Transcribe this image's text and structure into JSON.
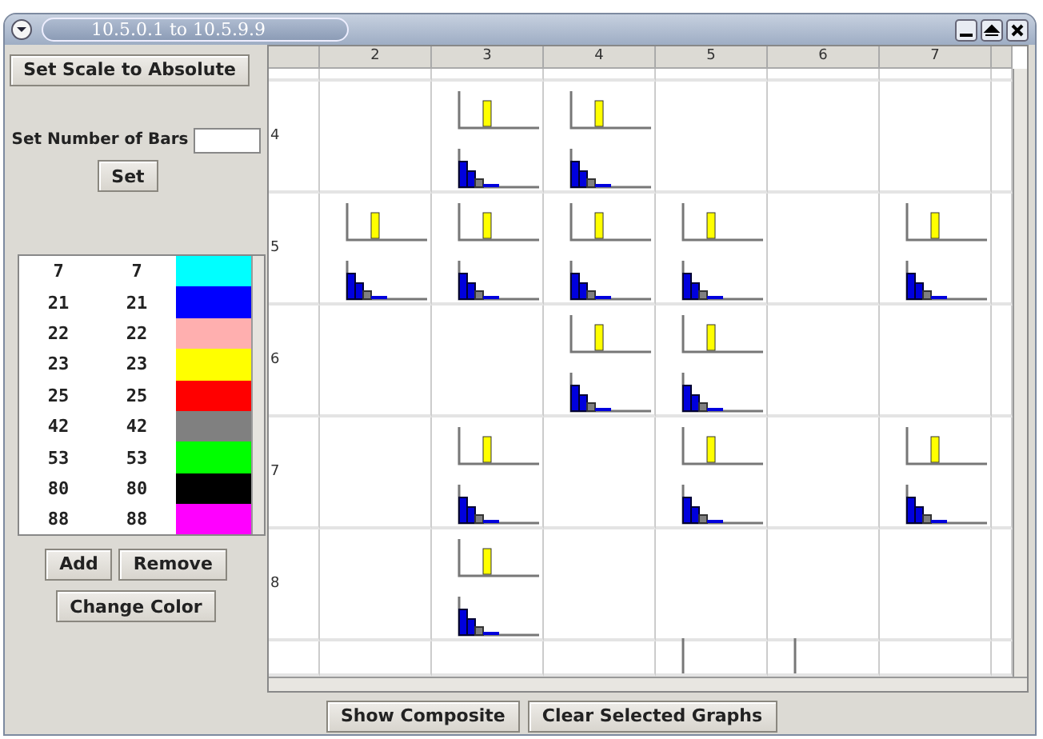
{
  "window": {
    "title": "10.5.0.1 to 10.5.9.9"
  },
  "scale_button": "Set Scale to Absolute",
  "bars_label": "Set Number of Bars",
  "set_button": "Set",
  "color_list": [
    {
      "from": "7",
      "to": "7",
      "color": "#00ffff"
    },
    {
      "from": "21",
      "to": "21",
      "color": "#0000ff"
    },
    {
      "from": "22",
      "to": "22",
      "color": "#ffafaf"
    },
    {
      "from": "23",
      "to": "23",
      "color": "#ffff00"
    },
    {
      "from": "25",
      "to": "25",
      "color": "#ff0000"
    },
    {
      "from": "42",
      "to": "42",
      "color": "#808080"
    },
    {
      "from": "53",
      "to": "53",
      "color": "#00ff00"
    },
    {
      "from": "80",
      "to": "80",
      "color": "#000000"
    },
    {
      "from": "88",
      "to": "88",
      "color": "#ff00ff"
    }
  ],
  "list_buttons": [
    "Add",
    "Remove",
    "Change Color"
  ],
  "grid": {
    "columns": [
      "2",
      "3",
      "4",
      "5",
      "6",
      "7"
    ],
    "rows": [
      {
        "label": "4",
        "cells": [
          {
            "graph": false
          },
          {
            "graph": true
          },
          {
            "graph": true
          },
          {
            "graph": false
          },
          {
            "graph": false
          },
          {
            "graph": false
          }
        ]
      },
      {
        "label": "5",
        "cells": [
          {
            "graph": true
          },
          {
            "graph": true
          },
          {
            "graph": true
          },
          {
            "graph": true
          },
          {
            "graph": false
          },
          {
            "graph": true
          }
        ]
      },
      {
        "label": "6",
        "cells": [
          {
            "graph": false
          },
          {
            "graph": false
          },
          {
            "graph": true
          },
          {
            "graph": true
          },
          {
            "graph": false
          },
          {
            "graph": false
          }
        ]
      },
      {
        "label": "7",
        "cells": [
          {
            "graph": false
          },
          {
            "graph": true
          },
          {
            "graph": false
          },
          {
            "graph": true
          },
          {
            "graph": false
          },
          {
            "graph": true
          }
        ]
      },
      {
        "label": "8",
        "cells": [
          {
            "graph": false
          },
          {
            "graph": true
          },
          {
            "graph": false
          },
          {
            "graph": false
          },
          {
            "graph": false
          },
          {
            "graph": false
          }
        ]
      }
    ],
    "partial_row": [
      {
        "graph": false
      },
      {
        "graph": false
      },
      {
        "graph": false
      },
      {
        "graph": true
      },
      {
        "graph": true
      },
      {
        "graph": false
      }
    ]
  },
  "bottom_buttons": [
    "Show Composite",
    "Clear Selected Graphs"
  ]
}
